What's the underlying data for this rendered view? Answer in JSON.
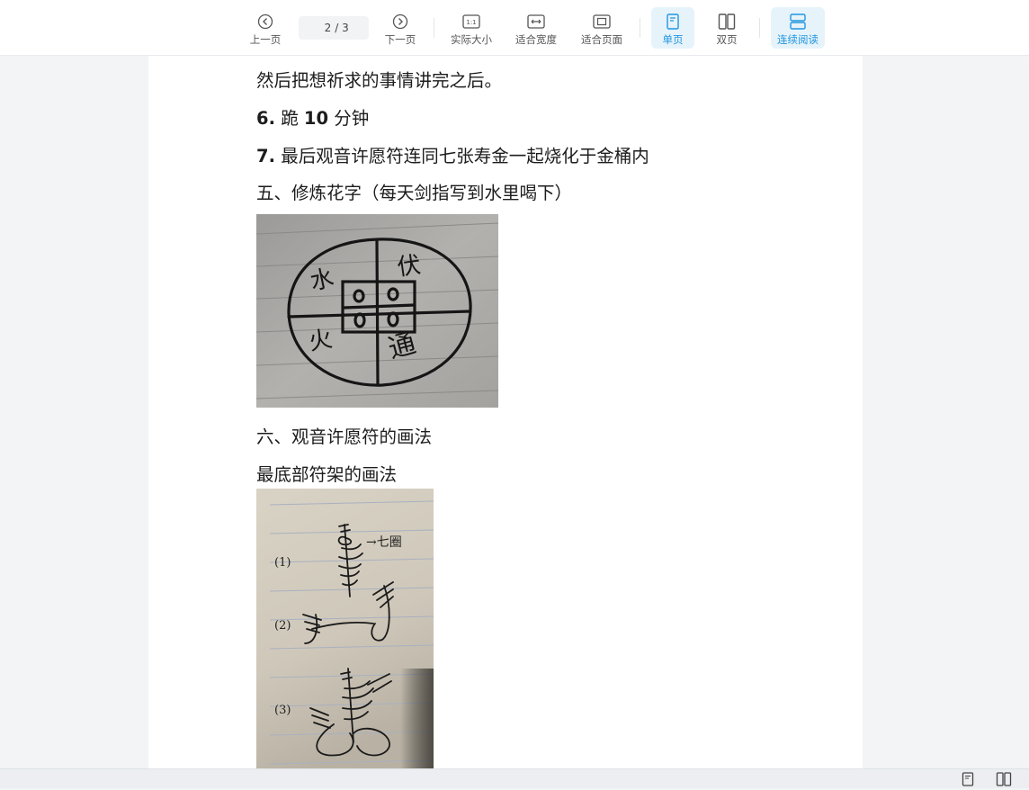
{
  "toolbar": {
    "prev_label": "上一页",
    "next_label": "下一页",
    "current_page": "2",
    "total_pages": "/ 3",
    "actual_size_label": "实际大小",
    "fit_width_label": "适合宽度",
    "fit_page_label": "适合页面",
    "single_page_label": "单页",
    "double_page_label": "双页",
    "continuous_label": "连续阅读",
    "actual_size_icon_text": "1:1"
  },
  "document": {
    "line1": "然后把想祈求的事情讲完之后。",
    "step6_num": "6.",
    "step6_text": "跪",
    "step6_value": "10",
    "step6_unit": "分钟",
    "step7_num": "7.",
    "step7_text": "最后观音许愿符连同七张寿金一起烧化于金桶内",
    "section5": "五、修炼花字（每天剑指写到水里喝下）",
    "section6": "六、观音许愿符的画法",
    "subheading": "最底部符架的画法"
  },
  "photo1": {
    "char_tl": "水",
    "char_tr": "伏",
    "char_bl": "火",
    "char_br": "通"
  },
  "photo2": {
    "label1": "(1)",
    "label2": "(2)",
    "label3": "(3)",
    "note": "→七圈"
  },
  "colors": {
    "accent": "#2196e0",
    "active_bg": "#e6f3fb",
    "page_bg": "#ffffff",
    "workspace_bg": "#f3f4f6"
  }
}
